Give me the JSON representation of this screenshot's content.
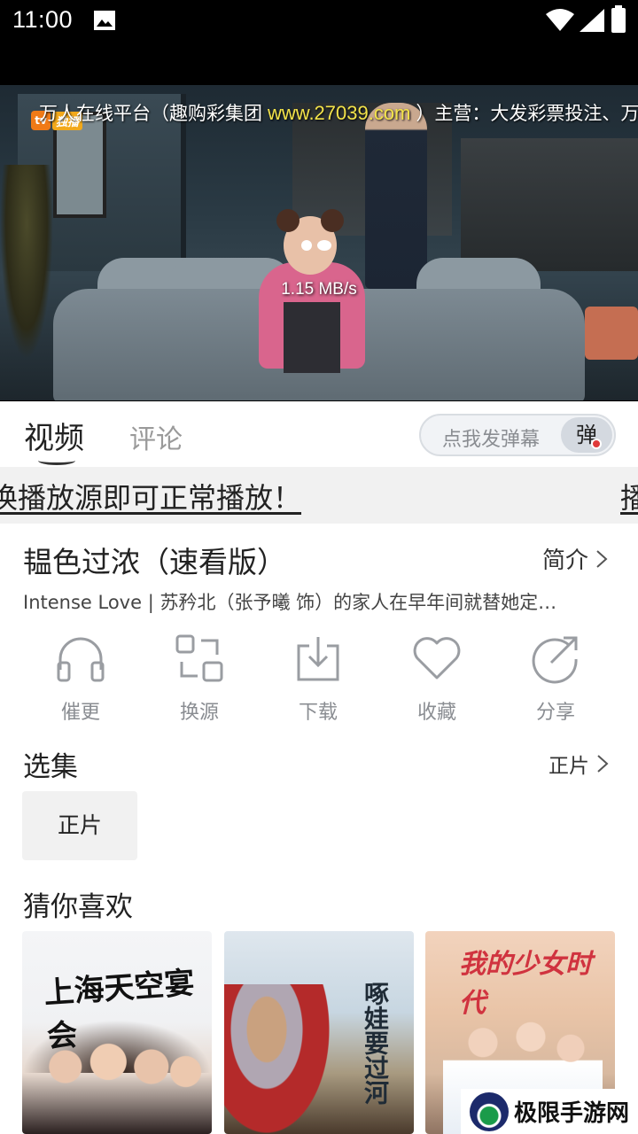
{
  "status_bar": {
    "time": "11:00"
  },
  "player": {
    "marquee_prefix": "万人在线平台（趣购彩集团",
    "marquee_url": "www.27039.com",
    "marquee_suffix": "）主营：大发彩票投注、万",
    "logo_text": "tv",
    "logo_tag": "独播",
    "net_speed": "1.15 MB/s"
  },
  "tabs": {
    "video": "视频",
    "comment": "评论"
  },
  "danmu": {
    "placeholder": "点我发弹幕",
    "button": "弹"
  },
  "notice": {
    "text": "换播放源即可正常播放！",
    "text_repeat": "播"
  },
  "show": {
    "title": "韫色过浓（速看版）",
    "intro_label": "简介",
    "description": "Intense Love | 苏矜北（张予曦 饰）的家人在早年间就替她定…"
  },
  "actions": [
    {
      "label": "催更",
      "icon": "headphones-icon"
    },
    {
      "label": "换源",
      "icon": "switch-source-icon"
    },
    {
      "label": "下载",
      "icon": "download-icon"
    },
    {
      "label": "收藏",
      "icon": "heart-icon"
    },
    {
      "label": "分享",
      "icon": "share-icon"
    }
  ],
  "episodes": {
    "label": "选集",
    "current": "正片",
    "items": [
      "正片"
    ]
  },
  "recommend": {
    "label": "猜你喜欢",
    "posters": [
      {
        "title_art": "上海天空宴会"
      },
      {
        "title_art": "啄娃要过河"
      },
      {
        "title_art": "我的少女时代"
      }
    ]
  },
  "watermark": {
    "text": "极限手游网"
  }
}
